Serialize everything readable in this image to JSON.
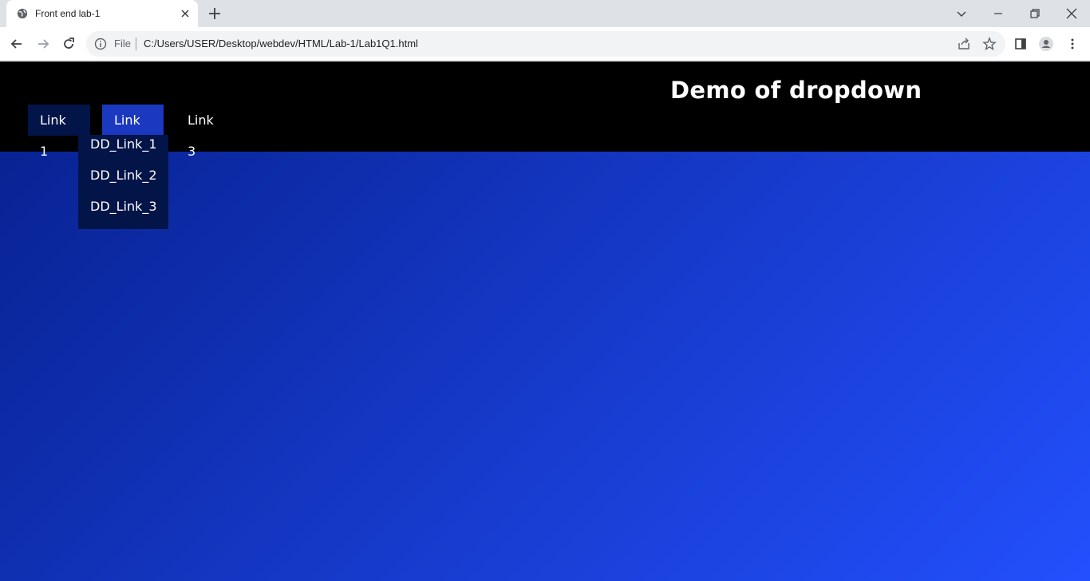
{
  "browser": {
    "tab_title": "Front end lab-1",
    "address_scheme_label": "File",
    "address_url": "C:/Users/USER/Desktop/webdev/HTML/Lab-1/Lab1Q1.html"
  },
  "page": {
    "title": "Demo of dropdown",
    "nav": [
      {
        "label": "Link 1"
      },
      {
        "label": "Link 2"
      },
      {
        "label": "Link 3"
      }
    ],
    "dropdown": [
      {
        "label": "DD_Link_1"
      },
      {
        "label": "DD_Link_2"
      },
      {
        "label": "DD_Link_3"
      }
    ]
  },
  "colors": {
    "header_bg": "#000000",
    "link_bg": "#031448",
    "link_active_bg": "#1a38c0",
    "gradient_start": "#06208c",
    "gradient_end": "#2350fd"
  }
}
